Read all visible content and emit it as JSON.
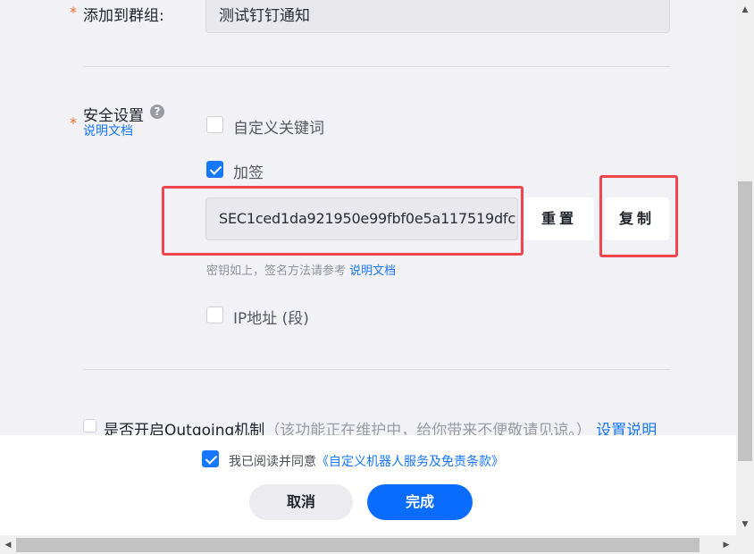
{
  "form": {
    "group": {
      "required_mark": "*",
      "label": "添加到群组:",
      "value": "测试钉钉通知"
    },
    "security": {
      "required_mark": "*",
      "label": "安全设置",
      "help_glyph": "?",
      "doc_link": "说明文档",
      "keyword_option": {
        "label": "自定义关键词",
        "checked": false
      },
      "sign_option": {
        "label": "加签",
        "checked": true
      },
      "secret_value": "SEC1ced1da921950e99fbf0e5a117519dfc",
      "reset_button": "重置",
      "copy_button": "复制",
      "hint_text": "密钥如上，签名方法请参考",
      "hint_link": "说明文档",
      "ip_option": {
        "label": "IP地址 (段)",
        "checked": false
      }
    },
    "outgoing": {
      "checked": false,
      "label": "是否开启Outgoing机制",
      "note": "（该功能正在维护中，给你带来不便敬请见谅。）",
      "link": "设置说明"
    }
  },
  "footer": {
    "agree_checked": true,
    "agree_text": "我已阅读并同意",
    "agree_link": "《自定义机器人服务及免责条款》",
    "cancel_button": "取消",
    "done_button": "完成"
  },
  "scrollbars": {
    "up_arrow": "▲",
    "down_arrow": "▼",
    "left_arrow": "◀",
    "right_arrow": "▶"
  },
  "colors": {
    "primary": "#0a6cff",
    "link": "#1677ff",
    "required": "#f06a26",
    "highlight": "#f0454d"
  }
}
